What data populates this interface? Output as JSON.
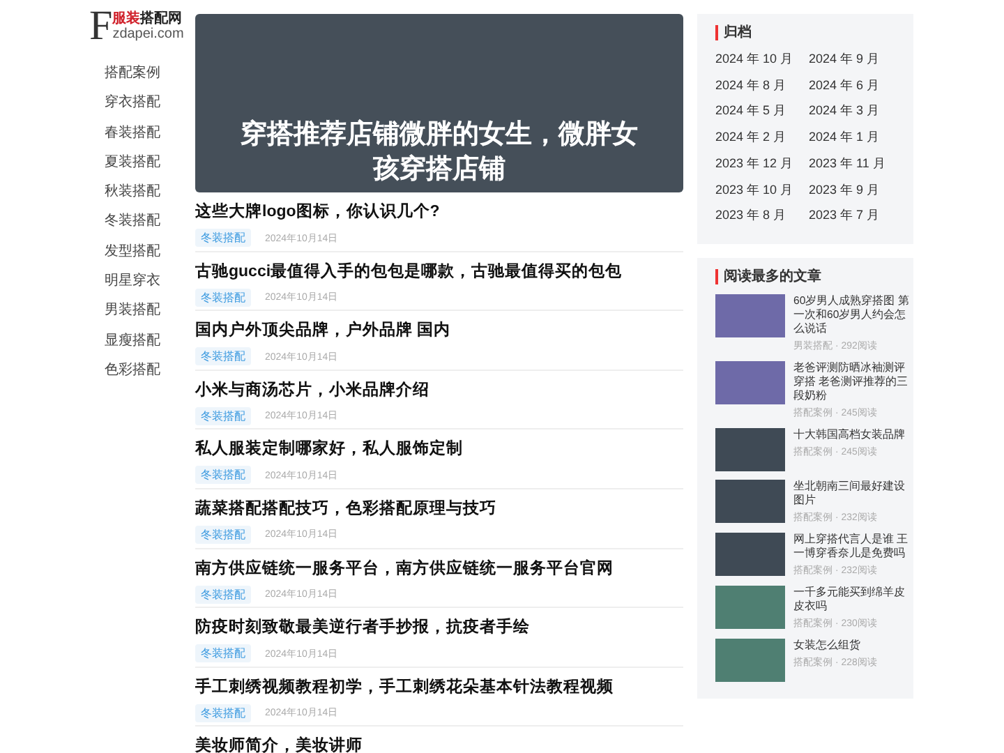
{
  "logo": {
    "letter": "F",
    "name_accent": "服装",
    "name": "搭配网",
    "domain": "zdapei.com"
  },
  "nav": [
    "搭配案例",
    "穿衣搭配",
    "春装搭配",
    "夏装搭配",
    "秋装搭配",
    "冬装搭配",
    "发型搭配",
    "明星穿衣",
    "男装搭配",
    "显瘦搭配",
    "色彩搭配"
  ],
  "hero": {
    "title": "穿搭推荐店铺微胖的女生，微胖女孩穿搭店铺"
  },
  "articles": [
    {
      "title": "这些大牌logo图标，你认识几个?",
      "tag": "冬装搭配",
      "date": "2024年10月14日"
    },
    {
      "title": "古驰gucci最值得入手的包包是哪款，古驰最值得买的包包",
      "tag": "冬装搭配",
      "date": "2024年10月14日"
    },
    {
      "title": "国内户外顶尖品牌，户外品牌 国内",
      "tag": "冬装搭配",
      "date": "2024年10月14日"
    },
    {
      "title": "小米与商汤芯片，小米品牌介绍",
      "tag": "冬装搭配",
      "date": "2024年10月14日"
    },
    {
      "title": "私人服装定制哪家好，私人服饰定制",
      "tag": "冬装搭配",
      "date": "2024年10月14日"
    },
    {
      "title": "蔬菜搭配搭配技巧，色彩搭配原理与技巧",
      "tag": "冬装搭配",
      "date": "2024年10月14日"
    },
    {
      "title": "南方供应链统一服务平台，南方供应链统一服务平台官网",
      "tag": "冬装搭配",
      "date": "2024年10月14日"
    },
    {
      "title": "防疫时刻致敬最美逆行者手抄报，抗疫者手绘",
      "tag": "冬装搭配",
      "date": "2024年10月14日"
    },
    {
      "title": "手工刺绣视频教程初学，手工刺绣花朵基本针法教程视频",
      "tag": "冬装搭配",
      "date": "2024年10月14日"
    },
    {
      "title": "美妆师简介，美妆讲师"
    }
  ],
  "archive": {
    "title": "归档",
    "months": [
      "2024 年 10 月",
      "2024 年 9 月",
      "2024 年 8 月",
      "2024 年 6 月",
      "2024 年 5 月",
      "2024 年 3 月",
      "2024 年 2 月",
      "2024 年 1 月",
      "2023 年 12 月",
      "2023 年 11 月",
      "2023 年 10 月",
      "2023 年 9 月",
      "2023 年 8 月",
      "2023 年 7 月"
    ]
  },
  "popular": {
    "title": "阅读最多的文章",
    "items": [
      {
        "title": "60岁男人成熟穿搭图 第一次和60岁男人约会怎么说话",
        "meta": "男装搭配 · 292阅读",
        "color": "#6e6aa8"
      },
      {
        "title": "老爸评测防晒冰袖测评穿搭 老爸测评推荐的三段奶粉",
        "meta": "搭配案例 · 245阅读",
        "color": "#6e6aa8"
      },
      {
        "title": "十大韩国高档女装品牌",
        "meta": "搭配案例 · 245阅读",
        "color": "#3f4a55"
      },
      {
        "title": "坐北朝南三间最好建设图片",
        "meta": "搭配案例 · 232阅读",
        "color": "#3f4a55"
      },
      {
        "title": "网上穿搭代言人是谁 王一博穿香奈儿是免费吗",
        "meta": "搭配案例 · 232阅读",
        "color": "#3f4a55"
      },
      {
        "title": "一千多元能买到绵羊皮皮衣吗",
        "meta": "搭配案例 · 230阅读",
        "color": "#4f7f72"
      },
      {
        "title": "女装怎么组货",
        "meta": "搭配案例 · 228阅读",
        "color": "#4f7f72"
      }
    ]
  }
}
